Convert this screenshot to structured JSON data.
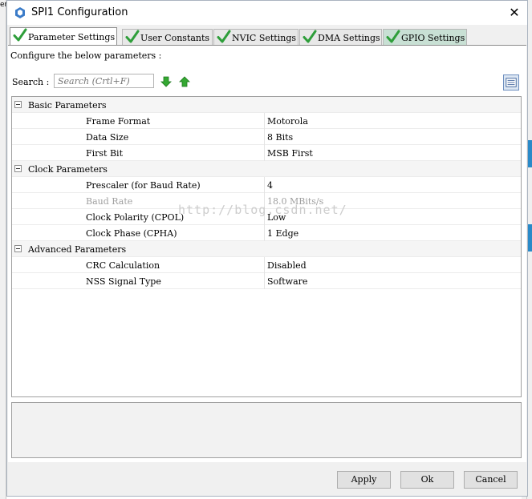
{
  "background": {
    "edge_text": "er"
  },
  "window": {
    "title": "SPI1 Configuration",
    "close_glyph": "✕"
  },
  "tabs": [
    {
      "label": "Parameter Settings",
      "active": true
    },
    {
      "label": "User Constants",
      "active": false
    },
    {
      "label": "NVIC Settings",
      "active": false
    },
    {
      "label": "DMA Settings",
      "active": false
    },
    {
      "label": "GPIO Settings",
      "active": false
    }
  ],
  "panel": {
    "configure_text": "Configure the below parameters :",
    "search_label": "Search :",
    "search_placeholder": "Search (Crtl+F)"
  },
  "groups": [
    {
      "name": "Basic Parameters",
      "params": [
        {
          "name": "Frame Format",
          "value": "Motorola",
          "enabled": true
        },
        {
          "name": "Data Size",
          "value": "8 Bits",
          "enabled": true
        },
        {
          "name": "First Bit",
          "value": "MSB First",
          "enabled": true
        }
      ]
    },
    {
      "name": "Clock Parameters",
      "params": [
        {
          "name": "Prescaler (for Baud Rate)",
          "value": "4",
          "enabled": true
        },
        {
          "name": "Baud Rate",
          "value": "18.0 MBits/s",
          "enabled": false
        },
        {
          "name": "Clock Polarity (CPOL)",
          "value": "Low",
          "enabled": true
        },
        {
          "name": "Clock Phase (CPHA)",
          "value": "1 Edge",
          "enabled": true
        }
      ]
    },
    {
      "name": "Advanced Parameters",
      "params": [
        {
          "name": "CRC Calculation",
          "value": "Disabled",
          "enabled": true
        },
        {
          "name": "NSS Signal Type",
          "value": "Software",
          "enabled": true
        }
      ]
    }
  ],
  "watermark": "http://blog.csdn.net/",
  "footer": {
    "apply_label": "Apply",
    "ok_label": "Ok",
    "cancel_label": "Cancel"
  },
  "icons": {
    "tab_status": "check-icon",
    "search_down": "arrow-down-icon",
    "search_up": "arrow-up-icon",
    "view_toggle": "list-view-icon"
  },
  "colors": {
    "check_green": "#2e9e3a",
    "arrow_green": "#34a832",
    "gpio_tab": "#c8e0d4",
    "accent_blue": "#2a8ac8"
  }
}
